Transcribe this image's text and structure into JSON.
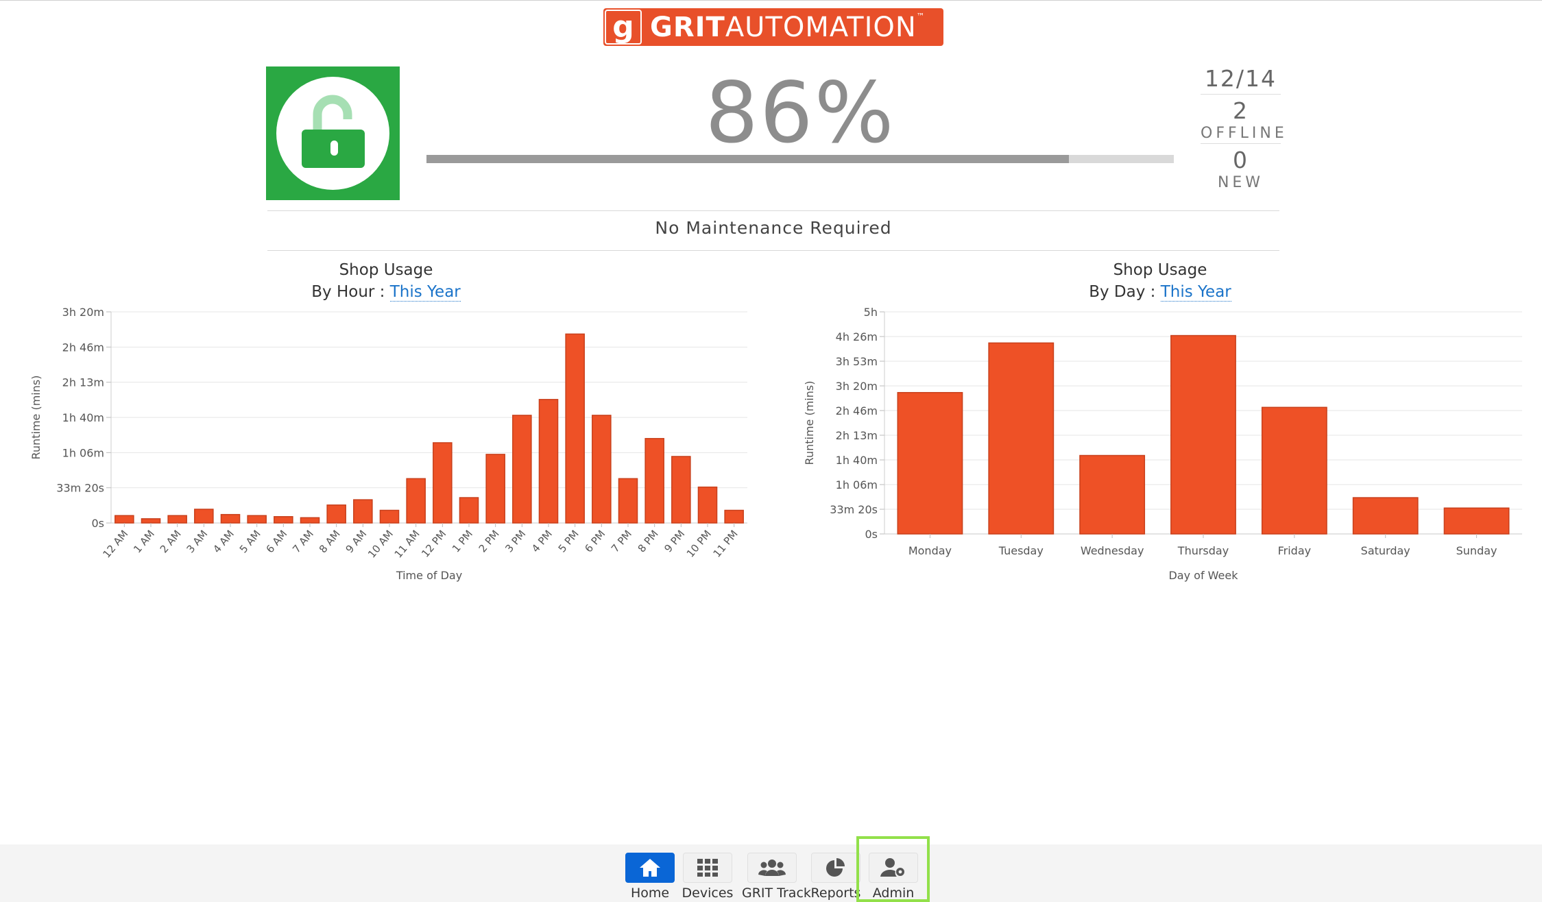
{
  "brand": {
    "mark": "g",
    "name_bold": "GRIT",
    "name_rest": "AUTOMATION",
    "tm": "™"
  },
  "status": {
    "percent_label": "86%",
    "percent_value": 0.86,
    "devices_ratio": "12/14",
    "offline_count": "2",
    "offline_label": "OFFLINE",
    "new_count": "0",
    "new_label": "NEW",
    "maintenance": "No Maintenance Required",
    "lock_color": "#2aa843",
    "lock_icon": "unlocked-padlock-icon"
  },
  "hour_chart": {
    "title": "Shop Usage",
    "subtitle_prefix": "By Hour :",
    "period": "This Year"
  },
  "day_chart": {
    "title": "Shop Usage",
    "subtitle_prefix": "By Day :",
    "period": "This Year"
  },
  "colors": {
    "bar": "#ee5126",
    "bar_stroke": "#c8401c",
    "accent": "#0a66d6",
    "highlight": "#92e04a"
  },
  "chart_data": [
    {
      "type": "bar",
      "title": "Shop Usage",
      "subtitle": "By Hour : This Year",
      "xlabel": "Time of Day",
      "ylabel": "Runtime (mins)",
      "ylim": [
        0,
        200
      ],
      "yticks": [
        0,
        33.333,
        66.667,
        100,
        133.333,
        166.667,
        200
      ],
      "ytick_labels": [
        "0s",
        "33m 20s",
        "1h 06m",
        "1h 40m",
        "2h 13m",
        "2h 46m",
        "3h 20m"
      ],
      "categories": [
        "12 AM",
        "1 AM",
        "2 AM",
        "3 AM",
        "4 AM",
        "5 AM",
        "6 AM",
        "7 AM",
        "8 AM",
        "9 AM",
        "10 AM",
        "11 AM",
        "12 PM",
        "1 PM",
        "2 PM",
        "3 PM",
        "4 PM",
        "5 PM",
        "6 PM",
        "7 PM",
        "8 PM",
        "9 PM",
        "10 PM",
        "11 PM"
      ],
      "values": [
        7,
        4,
        7,
        13,
        8,
        7,
        6,
        5,
        17,
        22,
        12,
        42,
        76,
        24,
        65,
        102,
        117,
        179,
        102,
        42,
        80,
        63,
        34,
        12
      ],
      "grid": true
    },
    {
      "type": "bar",
      "title": "Shop Usage",
      "subtitle": "By Day : This Year",
      "xlabel": "Day of Week",
      "ylabel": "Runtime (mins)",
      "ylim": [
        0,
        300
      ],
      "yticks": [
        0,
        33.333,
        66.667,
        100,
        133.333,
        166.667,
        200,
        233.333,
        266.667,
        300
      ],
      "ytick_labels": [
        "0s",
        "33m 20s",
        "1h 06m",
        "1h 40m",
        "2h 13m",
        "2h 46m",
        "3h 20m",
        "3h 53m",
        "4h 26m",
        "5h"
      ],
      "categories": [
        "Monday",
        "Tuesday",
        "Wednesday",
        "Thursday",
        "Friday",
        "Saturday",
        "Sunday"
      ],
      "values": [
        191,
        258,
        106,
        268,
        171,
        49,
        35
      ],
      "grid": true
    }
  ],
  "nav": [
    {
      "label": "Home",
      "icon": "home-icon",
      "active": true
    },
    {
      "label": "Devices",
      "icon": "grid-icon",
      "active": false
    },
    {
      "label": "GRIT Track",
      "icon": "users-icon",
      "active": false
    },
    {
      "label": "Reports",
      "icon": "pie-chart-icon",
      "active": false
    },
    {
      "label": "Admin",
      "icon": "user-gear-icon",
      "active": false,
      "highlighted": true
    }
  ]
}
